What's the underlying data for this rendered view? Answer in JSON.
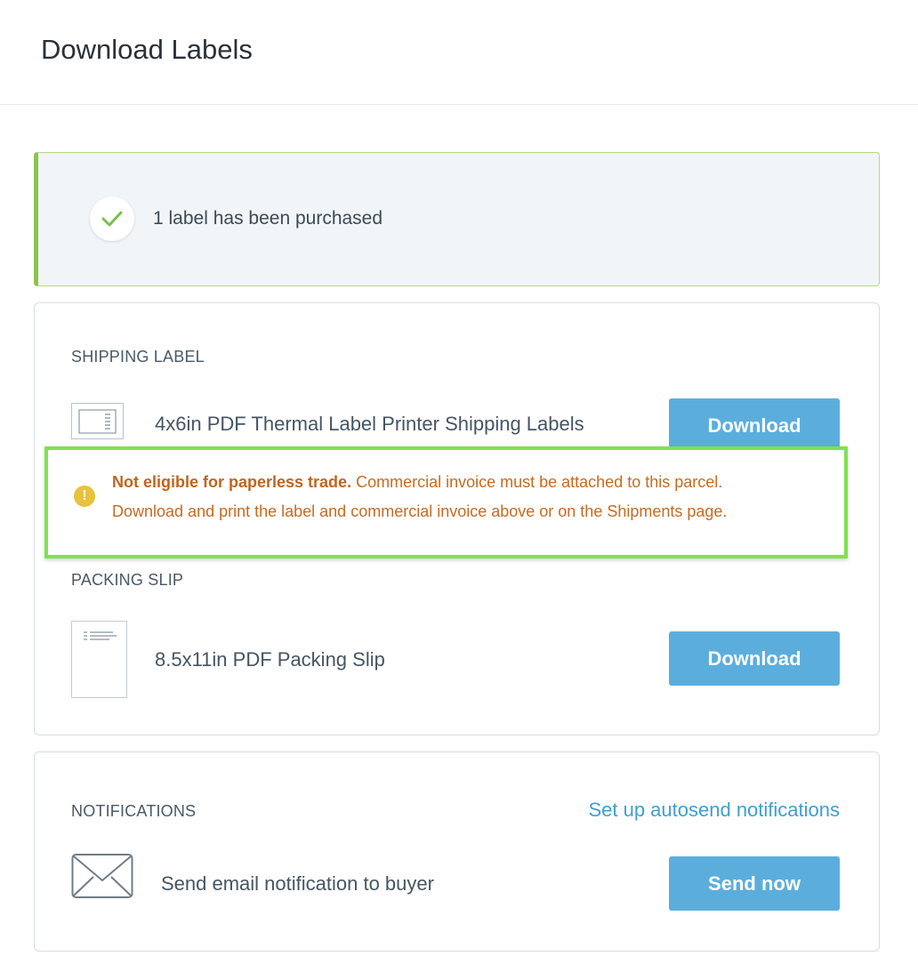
{
  "header": {
    "title": "Download Labels"
  },
  "success": {
    "message": "1 label has been purchased",
    "accent_color": "#8dc34a"
  },
  "shipping": {
    "heading": "SHIPPING LABEL",
    "item_title": "4x6in PDF Thermal Label Printer Shipping Labels",
    "button_label": "Download"
  },
  "warning": {
    "bold_text": "Not eligible for paperless trade.",
    "text_line1": " Commercial invoice must be attached to this parcel.",
    "text_line2": "Download and print the label and commercial invoice above or on the Shipments page.",
    "icon": "!",
    "color": "#c96a1f"
  },
  "packing": {
    "heading": "PACKING SLIP",
    "item_title": "8.5x11in PDF Packing Slip",
    "button_label": "Download"
  },
  "notifications": {
    "heading": "NOTIFICATIONS",
    "link_label": "Set up autosend notifications",
    "item_title": "Send email notification to buyer",
    "button_label": "Send now"
  },
  "colors": {
    "button": "#5baedc",
    "link": "#3d9fd6",
    "highlight": "#7de34e"
  }
}
